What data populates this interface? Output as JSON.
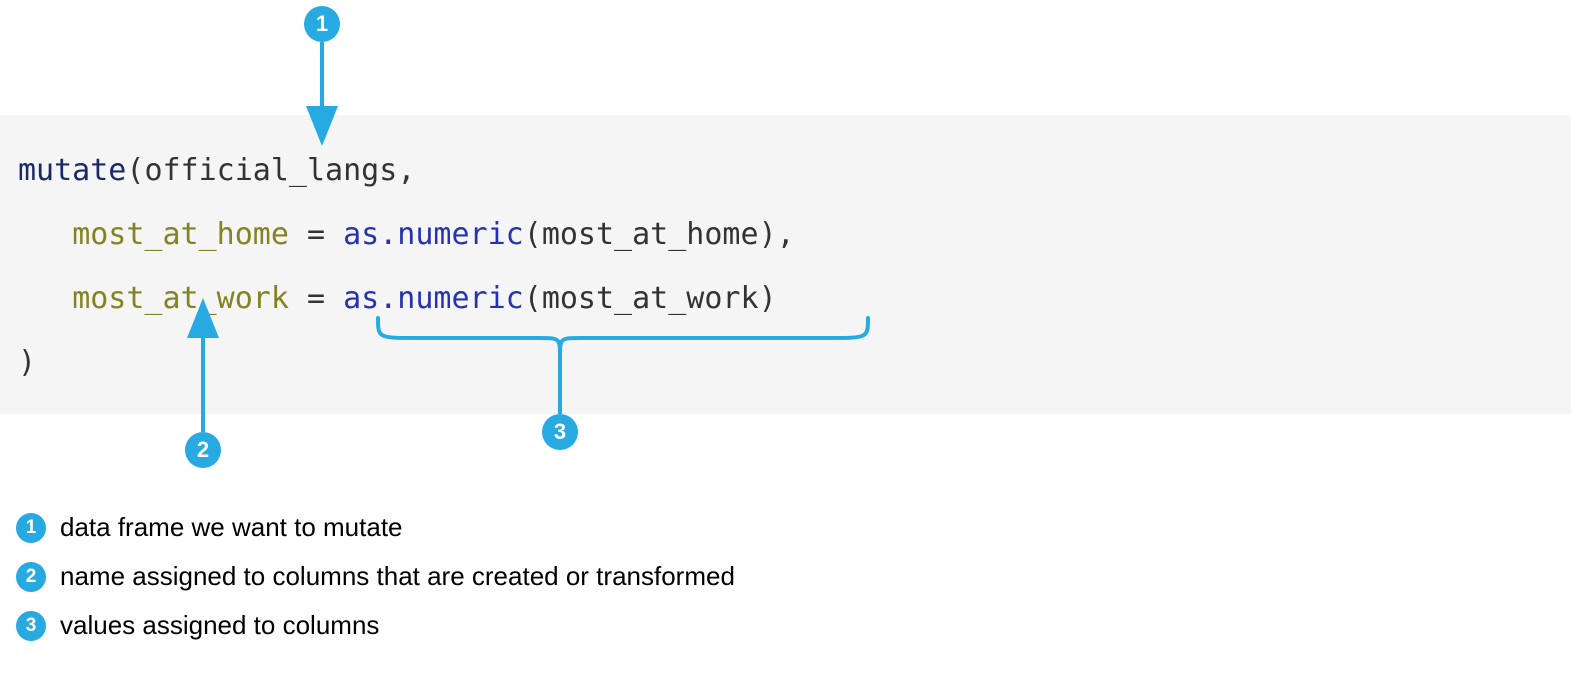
{
  "code": {
    "func": "mutate",
    "open": "(",
    "data_frame": "official_langs",
    "comma": ",",
    "indent": "   ",
    "arg1_name": "most_at_home",
    "eq": " = ",
    "call_fn": "as.numeric",
    "arg1_inner": "most_at_home",
    "arg2_name": "most_at_work",
    "arg2_inner": "most_at_work",
    "close_paren_inner": ")",
    "close_paren_outer": ")"
  },
  "callouts": {
    "c1": "1",
    "c2": "2",
    "c3": "3"
  },
  "legend": {
    "l1": "data frame we want to mutate",
    "l2": "name assigned to columns that are created or transformed",
    "l3": "values assigned to columns"
  },
  "colors": {
    "accent": "#27aae1"
  }
}
